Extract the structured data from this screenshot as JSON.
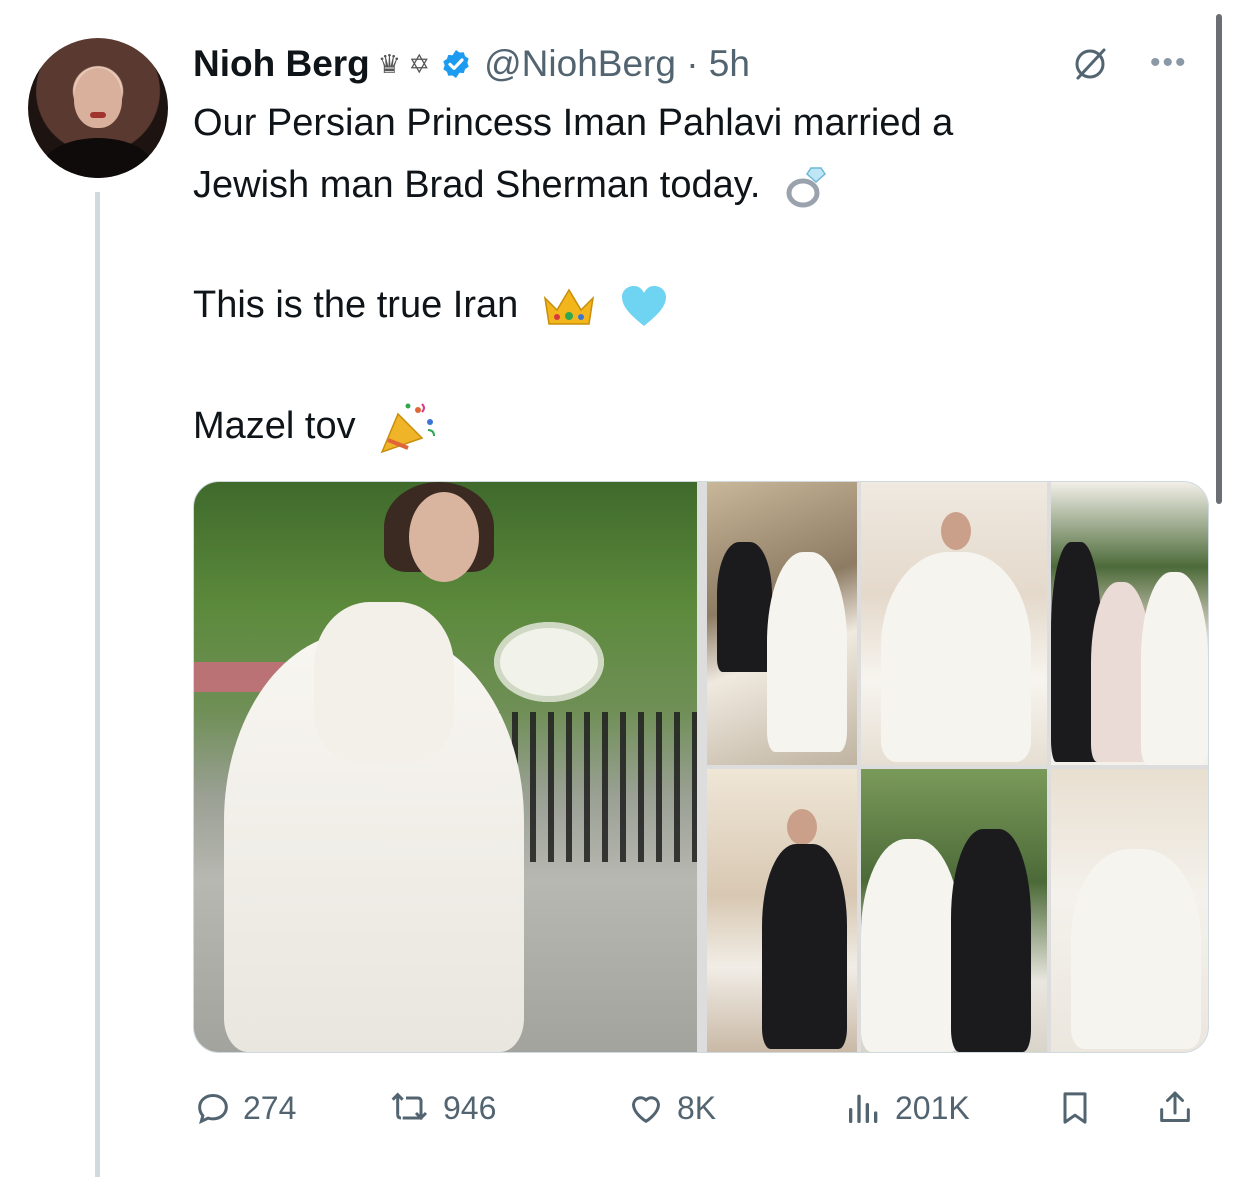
{
  "tweet": {
    "author_name": "Nioh Berg",
    "author_symbols": "♛ ✡",
    "handle_time": "@NiohBerg · 5h",
    "text_line1": "Our Persian Princess Iman Pahlavi married a",
    "text_line2": "Jewish man Brad Sherman today.",
    "text_line3": "This is the true Iran",
    "text_line4": "Mazel tov",
    "emoji_ring": "ring-emoji",
    "emoji_crown": "crown-emoji",
    "emoji_heart": "light-blue-heart-emoji",
    "emoji_party": "party-popper-emoji",
    "verified_color": "#1d9bf0"
  },
  "media": {
    "photo_count": 7
  },
  "actions": {
    "replies": "274",
    "reposts": "946",
    "likes": "8K",
    "views": "201K"
  }
}
